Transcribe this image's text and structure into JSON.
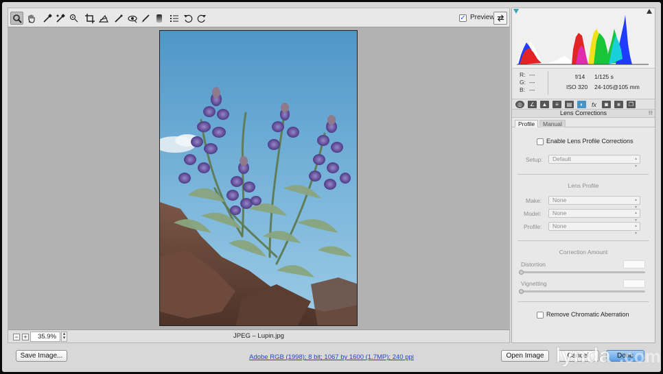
{
  "toolbar": {
    "tools": [
      {
        "name": "zoom-tool",
        "glyph": "🔍",
        "active": true
      },
      {
        "name": "hand-tool",
        "glyph": "✋",
        "active": false
      },
      {
        "name": "white-balance-tool",
        "glyph": "✒",
        "active": false
      },
      {
        "name": "color-sampler-tool",
        "glyph": "✒",
        "active": false
      },
      {
        "name": "targeted-adjustment-tool",
        "glyph": "◎",
        "active": false
      },
      {
        "name": "crop-tool",
        "glyph": "⌗",
        "active": false
      },
      {
        "name": "straighten-tool",
        "glyph": "⊿",
        "active": false
      },
      {
        "name": "spot-removal-tool",
        "glyph": "✎",
        "active": false
      },
      {
        "name": "red-eye-tool",
        "glyph": "◉",
        "active": false
      },
      {
        "name": "adjustment-brush-tool",
        "glyph": "🖌",
        "active": false
      },
      {
        "name": "graduated-filter-tool",
        "glyph": "▮",
        "active": false
      },
      {
        "name": "preferences-tool",
        "glyph": "☰",
        "active": false
      },
      {
        "name": "rotate-ccw-tool",
        "glyph": "↺",
        "active": false
      },
      {
        "name": "rotate-cw-tool",
        "glyph": "↻",
        "active": false
      }
    ],
    "preview_label": "Preview",
    "preview_checked": true
  },
  "status": {
    "zoom_minus": "−",
    "zoom_plus": "+",
    "zoom_value": "35.9%",
    "filename": "JPEG  –  Lupin.jpg"
  },
  "exif": {
    "r_label": "R:",
    "g_label": "G:",
    "b_label": "B:",
    "r_value": "---",
    "g_value": "---",
    "b_value": "---",
    "aperture": "f/14",
    "shutter": "1/125 s",
    "iso": "ISO 320",
    "lens": "24-105@105 mm"
  },
  "panel": {
    "title": "Lens Corrections",
    "menu_glyph": "☷",
    "tabs": {
      "profile": "Profile",
      "manual": "Manual"
    },
    "enable_label": "Enable Lens Profile Corrections",
    "setup_label": "Setup:",
    "setup_value": "Default",
    "lens_profile_title": "Lens Profile",
    "make_label": "Make:",
    "make_value": "None",
    "model_label": "Model:",
    "model_value": "None",
    "profile_label": "Profile:",
    "profile_value": "None",
    "correction_title": "Correction Amount",
    "distortion_label": "Distortion",
    "vignetting_label": "Vignetting",
    "chromatic_label": "Remove Chromatic Aberration"
  },
  "buttons": {
    "save_image": "Save Image...",
    "open_image": "Open Image",
    "cancel": "Cancel",
    "done": "Done"
  },
  "workflow_link": "Adobe RGB (1998); 8 bit; 1067 by 1600 (1.7MP); 240 ppi",
  "watermark": "lynda.com",
  "colors": {
    "accent_blue": "#4a93c5",
    "link_blue": "#1f45c7"
  }
}
